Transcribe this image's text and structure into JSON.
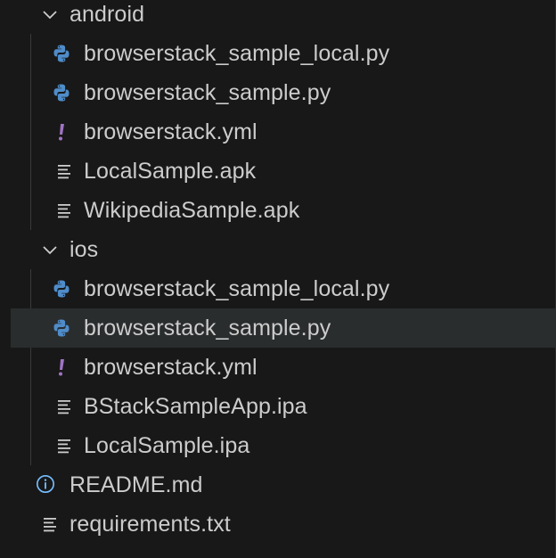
{
  "tree": {
    "items": [
      {
        "label": "android",
        "icon": "chevron-down-icon",
        "depth": 0
      },
      {
        "label": "browserstack_sample_local.py",
        "icon": "python-icon",
        "depth": 1
      },
      {
        "label": "browserstack_sample.py",
        "icon": "python-icon",
        "depth": 1
      },
      {
        "label": "browserstack.yml",
        "icon": "yaml-exclamation-icon",
        "depth": 1
      },
      {
        "label": "LocalSample.apk",
        "icon": "file-lines-icon",
        "depth": 1
      },
      {
        "label": "WikipediaSample.apk",
        "icon": "file-lines-icon",
        "depth": 1
      },
      {
        "label": "ios",
        "icon": "chevron-down-icon",
        "depth": 0
      },
      {
        "label": "browserstack_sample_local.py",
        "icon": "python-icon",
        "depth": 1
      },
      {
        "label": "browserstack_sample.py",
        "icon": "python-icon",
        "depth": 1,
        "selected": true
      },
      {
        "label": "browserstack.yml",
        "icon": "yaml-exclamation-icon",
        "depth": 1
      },
      {
        "label": "BStackSampleApp.ipa",
        "icon": "file-lines-icon",
        "depth": 1
      },
      {
        "label": "LocalSample.ipa",
        "icon": "file-lines-icon",
        "depth": 1
      },
      {
        "label": "README.md",
        "icon": "info-icon",
        "depth": 0
      },
      {
        "label": "requirements.txt",
        "icon": "file-lines-icon",
        "depth": 0
      }
    ]
  },
  "colors": {
    "background": "#181818",
    "text": "#cccccc",
    "selected_row": "#2a2d2e",
    "python_blue": "#4f8cc9",
    "yaml_purple": "#a074c4",
    "info_blue": "#75beff",
    "guide": "#3a3a3a"
  }
}
